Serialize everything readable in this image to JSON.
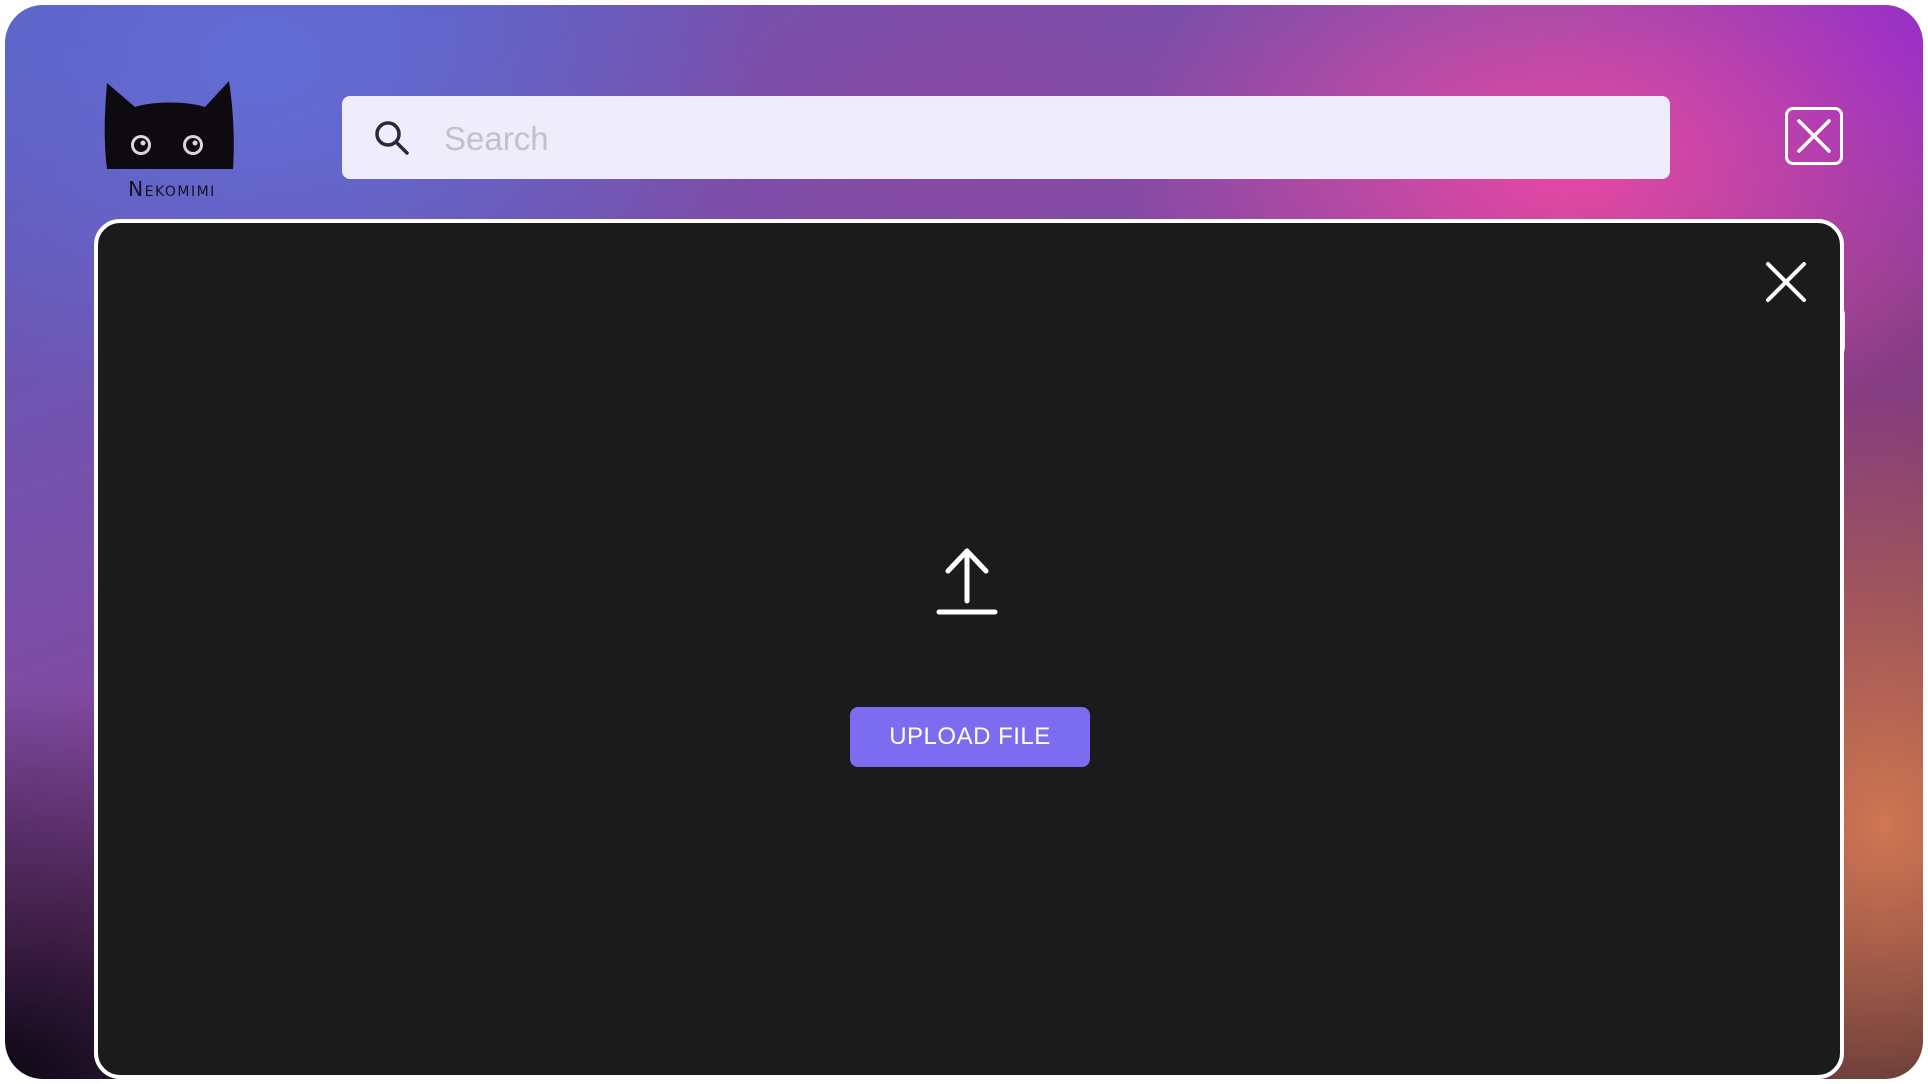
{
  "brand": {
    "name": "Nekomimi",
    "logo_icon": "cat-ears-icon"
  },
  "search": {
    "placeholder": "Search",
    "value": "",
    "icon": "search-icon"
  },
  "window": {
    "close_icon": "close-icon"
  },
  "upload_modal": {
    "close_icon": "close-icon",
    "upload_icon": "upload-arrow-icon",
    "button_label": "UPLOAD FILE",
    "accent_color": "#7b6cf0"
  }
}
